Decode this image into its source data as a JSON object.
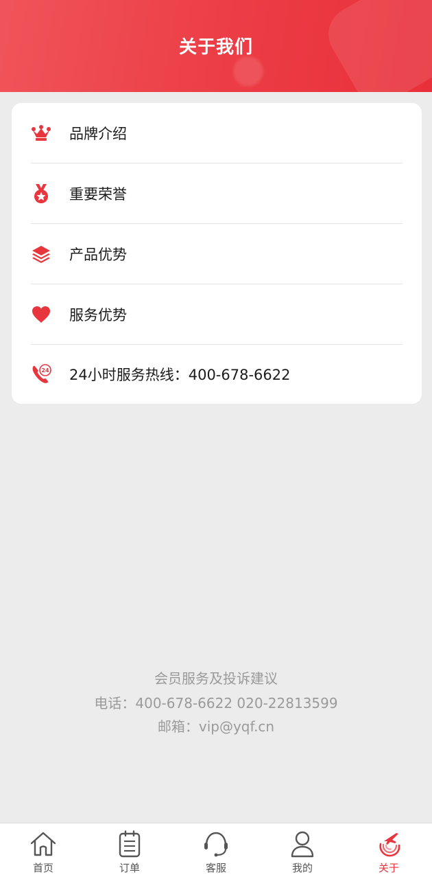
{
  "header": {
    "title": "关于我们"
  },
  "menu": {
    "items": [
      {
        "label": "品牌介绍",
        "icon": "crown-icon"
      },
      {
        "label": "重要荣誉",
        "icon": "medal-icon"
      },
      {
        "label": "产品优势",
        "icon": "layers-icon"
      },
      {
        "label": "服务优势",
        "icon": "heart-icon"
      },
      {
        "label": "24小时服务热线：400-678-6622",
        "icon": "phone-24h-icon"
      }
    ]
  },
  "footer": {
    "line1": "会员服务及投诉建议",
    "line2": "电话：400-678-6622 020-22813599",
    "line3": "邮箱：vip@yqf.cn"
  },
  "tabbar": {
    "items": [
      {
        "label": "首页",
        "icon": "home-icon"
      },
      {
        "label": "订单",
        "icon": "clipboard-icon"
      },
      {
        "label": "客服",
        "icon": "headset-icon"
      },
      {
        "label": "我的",
        "icon": "user-icon"
      },
      {
        "label": "关于",
        "icon": "plane-logo-icon",
        "active": true
      }
    ]
  },
  "colors": {
    "accent": "#e8363f",
    "background": "#ececec",
    "card": "#ffffff"
  }
}
